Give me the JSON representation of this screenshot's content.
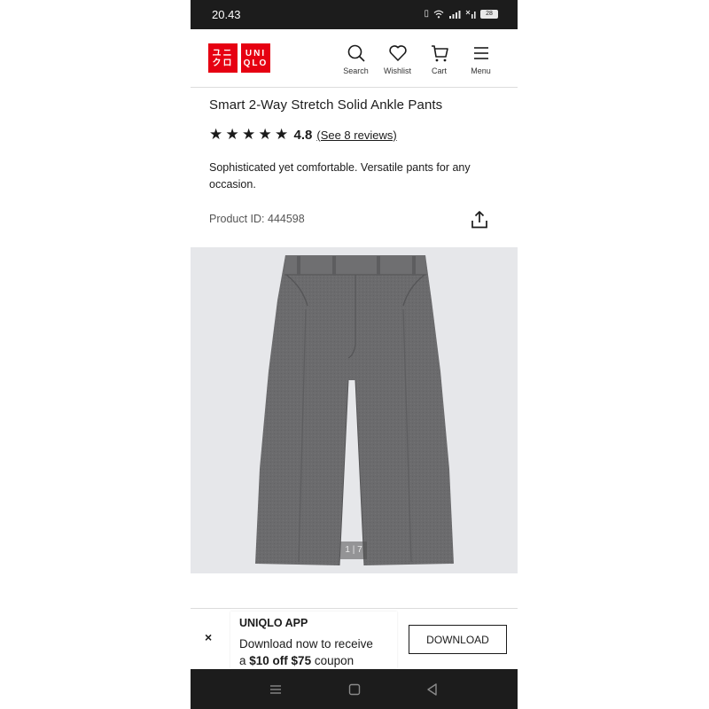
{
  "status_bar": {
    "time": "20.43",
    "battery": "28"
  },
  "header": {
    "logo_top": "ユニクロ",
    "logo_bottom": "UNIQLO",
    "nav": [
      {
        "label": "Search",
        "icon": "search-icon"
      },
      {
        "label": "Wishlist",
        "icon": "heart-icon"
      },
      {
        "label": "Cart",
        "icon": "cart-icon"
      },
      {
        "label": "Menu",
        "icon": "menu-icon"
      }
    ]
  },
  "product": {
    "title": "Smart 2-Way Stretch Solid Ankle Pants",
    "rating_stars": 5,
    "rating_value": "4.8",
    "reviews_label": "(See 8 reviews)",
    "description": "Sophisticated yet comfortable. Versatile pants for any occasion.",
    "product_id": "Product ID: 444598",
    "image_counter": "1 | 7"
  },
  "app_banner": {
    "title": "UNIQLO APP",
    "text_line1": "Download now to receive",
    "text_prefix": "a ",
    "text_bold1": "$10 off",
    "text_mid": " ",
    "text_bold2": "$75",
    "text_suffix": " coupon",
    "button": "DOWNLOAD",
    "close": "×"
  },
  "colors": {
    "brand_red": "#e60012",
    "pants_gray": "#6b6b6d",
    "image_bg": "#e6e7ea"
  }
}
